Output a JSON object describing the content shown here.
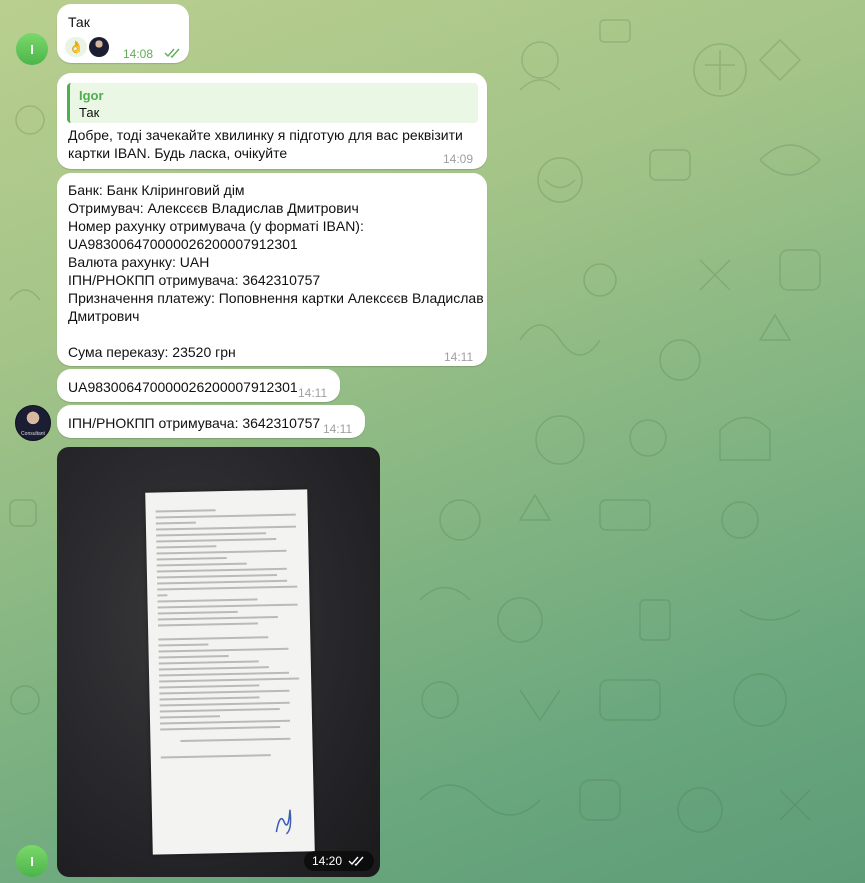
{
  "chat": {
    "messages": [
      {
        "sender_initial": "I",
        "text": "Так",
        "time": "14:08",
        "reaction_emoji": "👌"
      },
      {
        "reply_name": "Igor",
        "reply_text": "Так",
        "lines": [
          "Добре, тоді зачекайте хвилинку я підготую для вас реквізити",
          "картки IBAN. Будь ласка, очікуйте"
        ],
        "time": "14:09"
      },
      {
        "lines": [
          "Банк: Банк Кліринговий дім",
          "Отримувач: Алексєєв Владислав Дмитрович",
          "Номер рахунку отримувача (у форматі IBAN):",
          "UA983006470000026200007912301",
          "Валюта рахунку: UAH",
          "ІПН/РНОКПП отримувача: 3642310757",
          "Призначення платежу: Поповнення картки Алексєєв Владислав",
          "Дмитрович",
          "",
          "Сума переказу: 23520 грн"
        ],
        "time": "14:11"
      },
      {
        "text": "UA983006470000026200007912301",
        "time": "14:11"
      },
      {
        "text": "ІПН/РНОКПП отримувача: 3642310757",
        "time": "14:11",
        "avatar_caption": "Consultant"
      },
      {
        "type": "photo",
        "time": "14:20",
        "sender_initial": "I"
      }
    ]
  },
  "icons": {
    "read_receipt": "double-check-icon"
  }
}
